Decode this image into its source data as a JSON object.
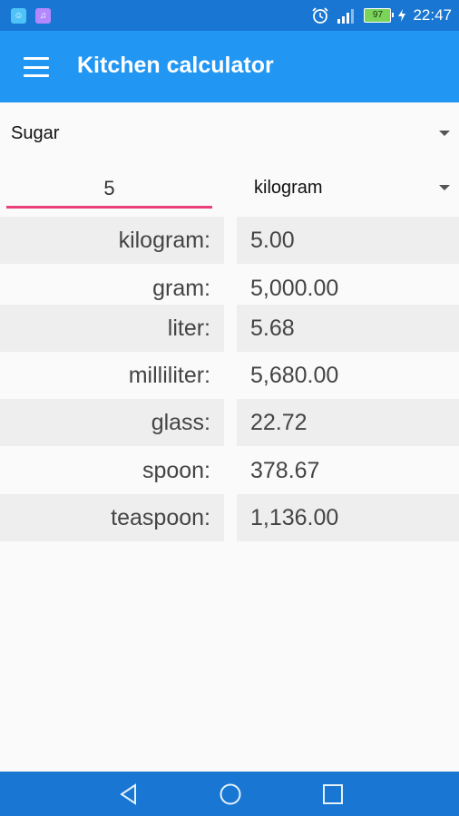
{
  "status": {
    "time": "22:47",
    "battery": "97",
    "notif_a": "☺",
    "notif_b": "♫"
  },
  "appbar": {
    "title": "Kitchen calculator",
    "menu_icon": "hamburger-menu-icon"
  },
  "ingredient": {
    "selected": "Sugar"
  },
  "input": {
    "amount": "5",
    "unit_selected": "kilogram"
  },
  "results": [
    {
      "label": "kilogram:",
      "value": "5.00"
    },
    {
      "label": "gram:",
      "value": "5,000.00"
    },
    {
      "label": "liter:",
      "value": "5.68"
    },
    {
      "label": "milliliter:",
      "value": "5,680.00"
    },
    {
      "label": "glass:",
      "value": "22.72"
    },
    {
      "label": "spoon:",
      "value": "378.67"
    },
    {
      "label": "teaspoon:",
      "value": "1,136.00"
    }
  ],
  "colors": {
    "status_bar": "#1976d2",
    "app_bar": "#2196f3",
    "accent": "#ec407a",
    "row_shade": "#eeeeee"
  }
}
